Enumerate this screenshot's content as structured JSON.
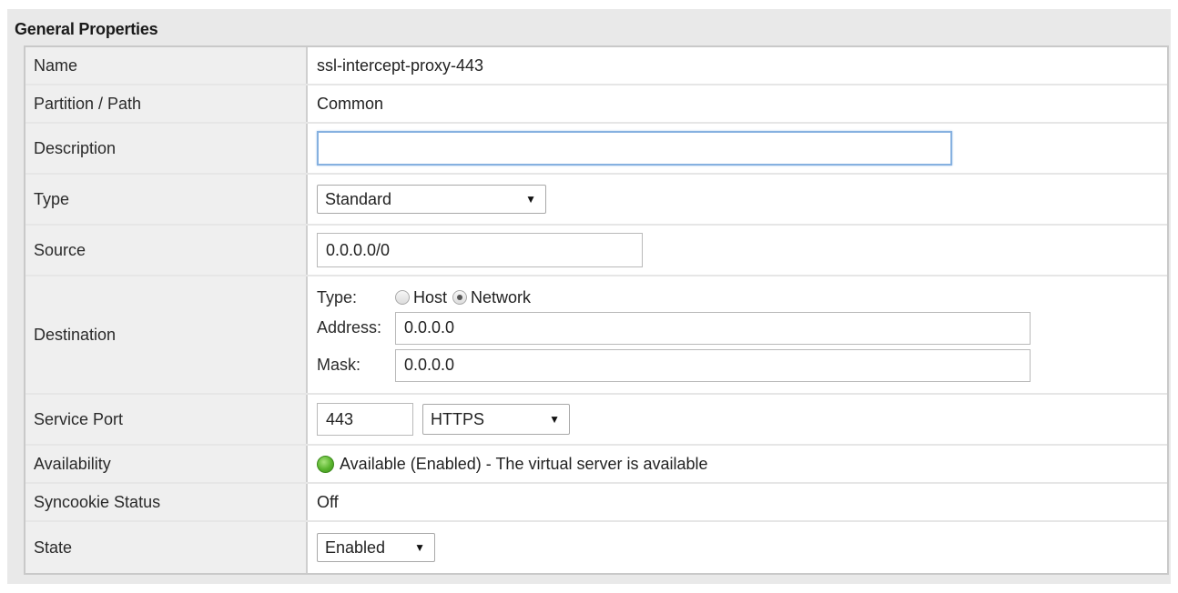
{
  "section": {
    "title": "General Properties"
  },
  "rows": {
    "name": {
      "label": "Name",
      "value": "ssl-intercept-proxy-443"
    },
    "partition": {
      "label": "Partition / Path",
      "value": "Common"
    },
    "description": {
      "label": "Description",
      "value": ""
    },
    "type": {
      "label": "Type",
      "selected": "Standard"
    },
    "source": {
      "label": "Source",
      "value": "0.0.0.0/0"
    },
    "destination": {
      "label": "Destination",
      "type_label": "Type:",
      "option_host": "Host",
      "option_network": "Network",
      "selected_option": "Network",
      "address_label": "Address:",
      "address_value": "0.0.0.0",
      "mask_label": "Mask:",
      "mask_value": "0.0.0.0"
    },
    "service_port": {
      "label": "Service Port",
      "port": "443",
      "protocol": "HTTPS"
    },
    "availability": {
      "label": "Availability",
      "status_text": "Available (Enabled) - The virtual server is available",
      "status_color": "#59b42d",
      "icon": "green-circle-icon"
    },
    "syncookie": {
      "label": "Syncookie Status",
      "value": "Off"
    },
    "state": {
      "label": "State",
      "selected": "Enabled"
    }
  }
}
